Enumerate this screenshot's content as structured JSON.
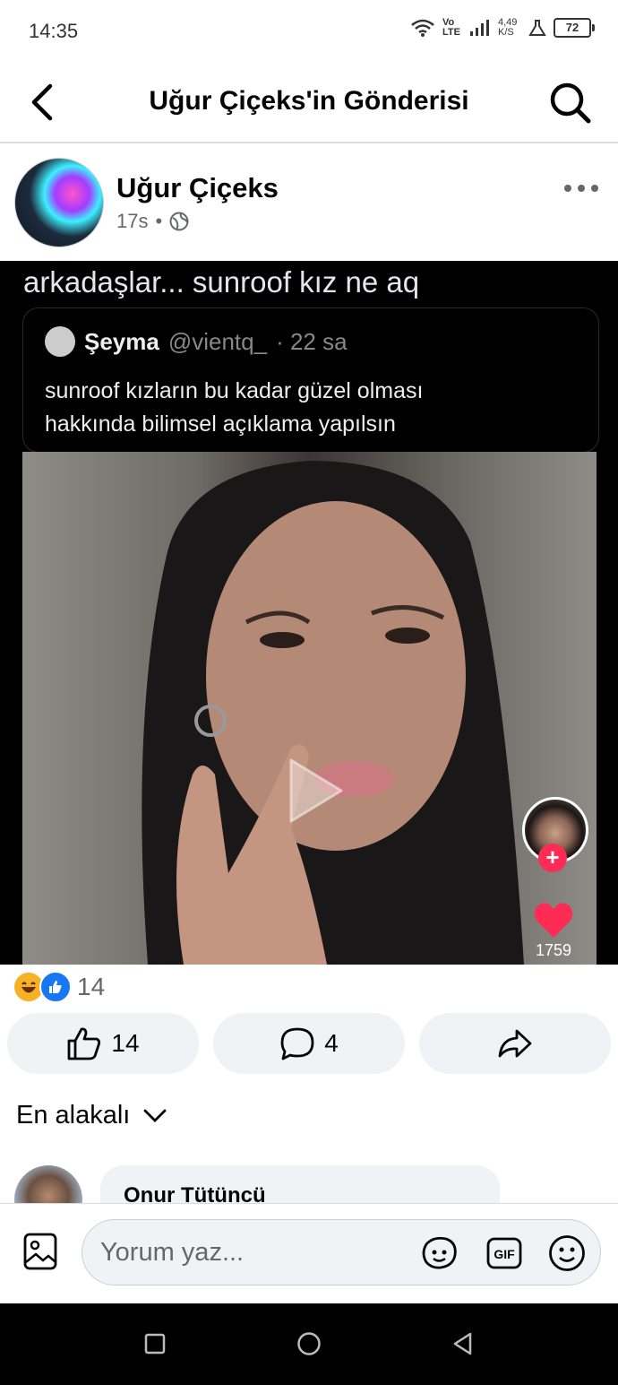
{
  "status_bar": {
    "time": "14:35",
    "volte": "Vo LTE",
    "speed": "4,49 K/S",
    "battery": "72",
    "icons": [
      "wifi-icon",
      "signal-icon",
      "flask-icon",
      "battery-icon"
    ]
  },
  "header": {
    "title": "Uğur Çiçeks'in Gönderisi",
    "icons": [
      "back-arrow-icon",
      "search-icon"
    ]
  },
  "post": {
    "author": "Uğur Çiçeks",
    "time": "17s",
    "separator": "•",
    "privacy_icon": "globe-icon",
    "caption": "arkadaşlar... sunroof kız ne aq",
    "tweet": {
      "name": "Şeyma",
      "handle": "@vientq_",
      "time": "· 22 sa",
      "text_line1": "sunroof kızların bu kadar güzel olması",
      "text_line2": "hakkında bilimsel açıklama yapılsın"
    },
    "video": {
      "like_count": "1759",
      "plus": "+"
    }
  },
  "reactions": {
    "icons": [
      "haha-icon",
      "like-icon"
    ],
    "count": "14"
  },
  "actions": {
    "like_count": "14",
    "comment_count": "4"
  },
  "sort": {
    "label": "En alakalı"
  },
  "comments": [
    {
      "author": "Onur Tütüncü"
    }
  ],
  "composer": {
    "placeholder": "Yorum yaz..."
  },
  "colors": {
    "accent": "#1877f2",
    "tiktok_red": "#fe2c55",
    "surface": "#f0f2f5",
    "secondary_text": "#65676b"
  }
}
